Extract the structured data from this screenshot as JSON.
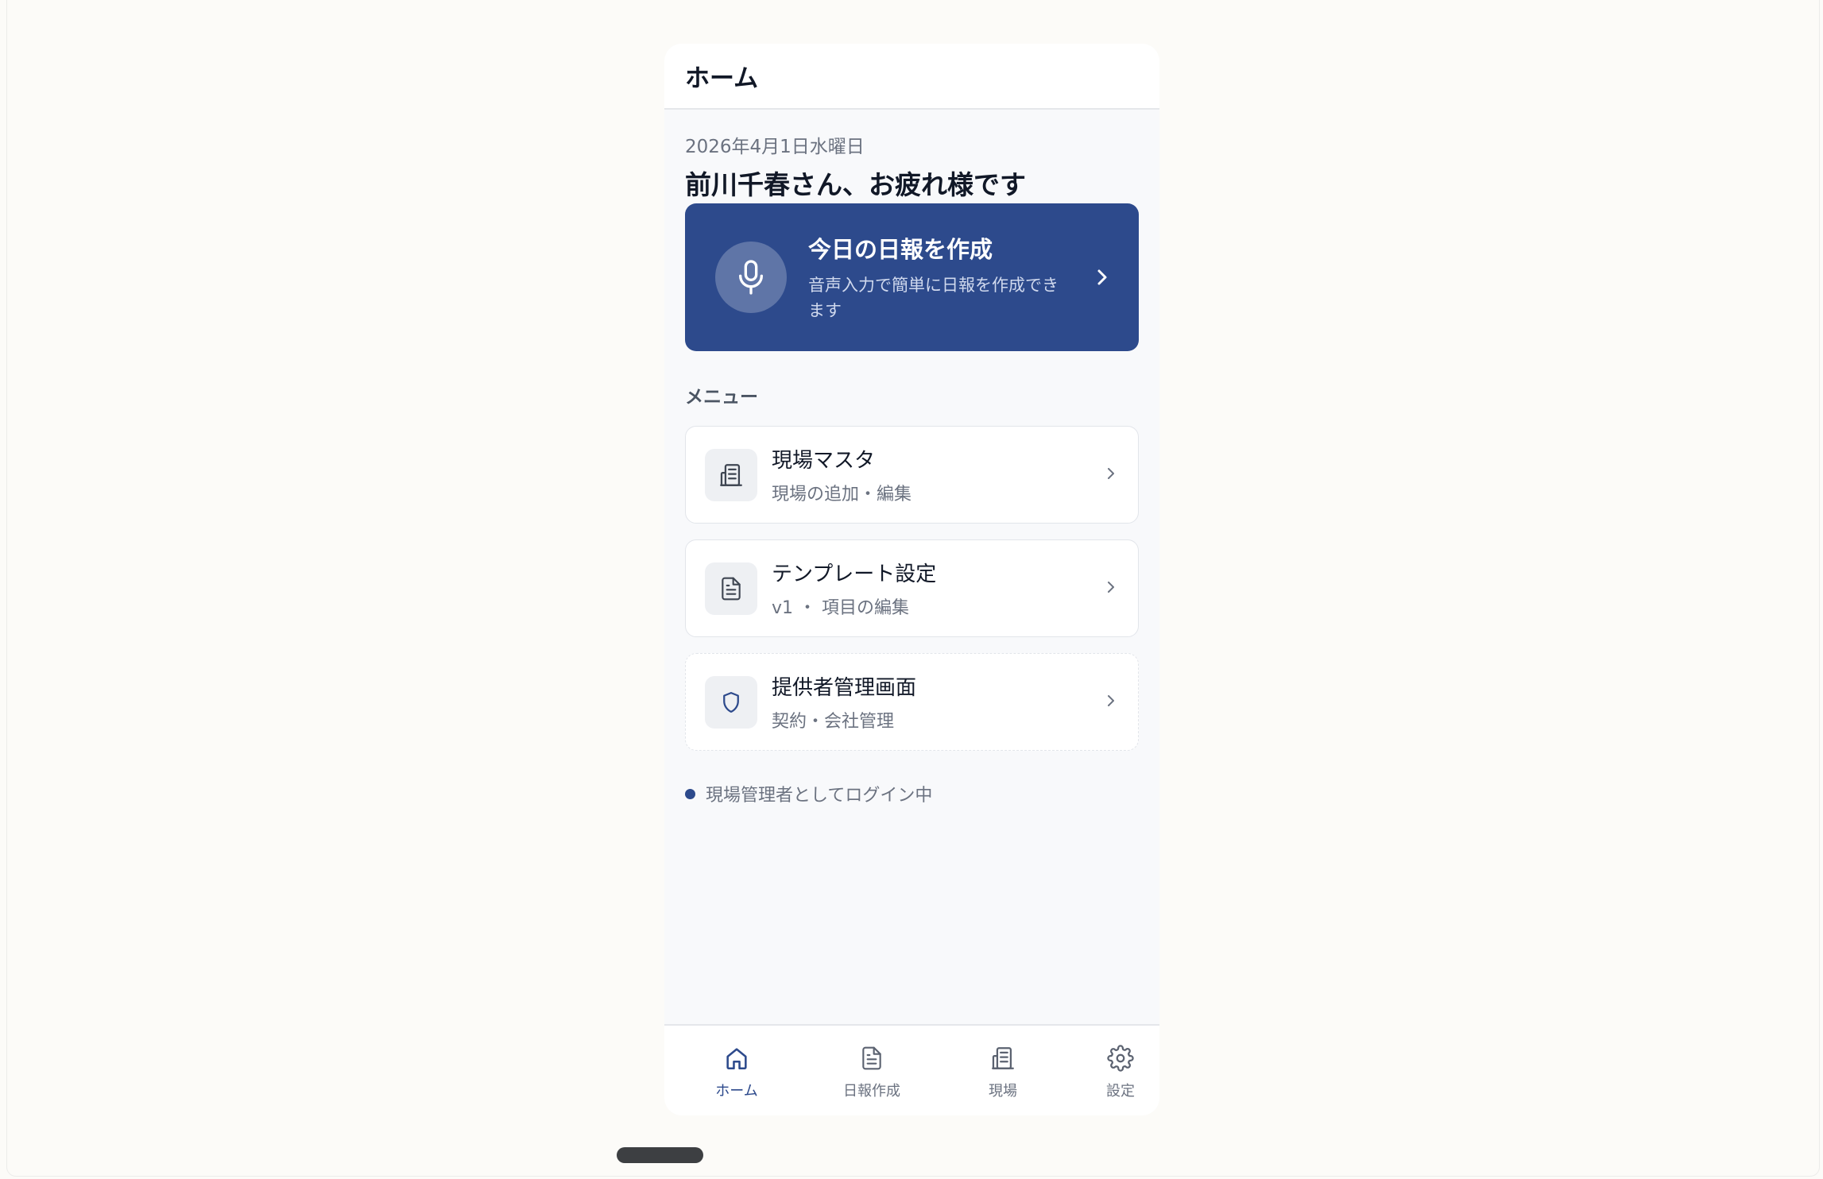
{
  "header": {
    "title": "ホーム"
  },
  "date": "2026年4月1日水曜日",
  "greeting": "前川千春さん、お疲れ様です",
  "cta": {
    "title": "今日の日報を作成",
    "subtitle": "音声入力で簡単に日報を作成できます",
    "icon": "microphone-icon"
  },
  "menu": {
    "label": "メニュー",
    "items": [
      {
        "title": "現場マスタ",
        "subtitle": "現場の追加・編集",
        "icon": "building-icon"
      },
      {
        "title": "テンプレート設定",
        "subtitle": "v1 ・ 項目の編集",
        "icon": "document-icon"
      },
      {
        "title": "提供者管理画面",
        "subtitle": "契約・会社管理",
        "icon": "shield-icon"
      }
    ]
  },
  "status": {
    "text": "現場管理者としてログイン中"
  },
  "nav": {
    "items": [
      {
        "label": "ホーム",
        "icon": "home-icon",
        "active": true
      },
      {
        "label": "日報作成",
        "icon": "document-icon",
        "active": false
      },
      {
        "label": "現場",
        "icon": "building-icon",
        "active": false
      },
      {
        "label": "設定",
        "icon": "gear-icon",
        "active": false
      }
    ]
  },
  "colors": {
    "primary": "#2d4a8c",
    "background": "#f8f9fb",
    "text": "#111827",
    "muted": "#6b7280"
  }
}
